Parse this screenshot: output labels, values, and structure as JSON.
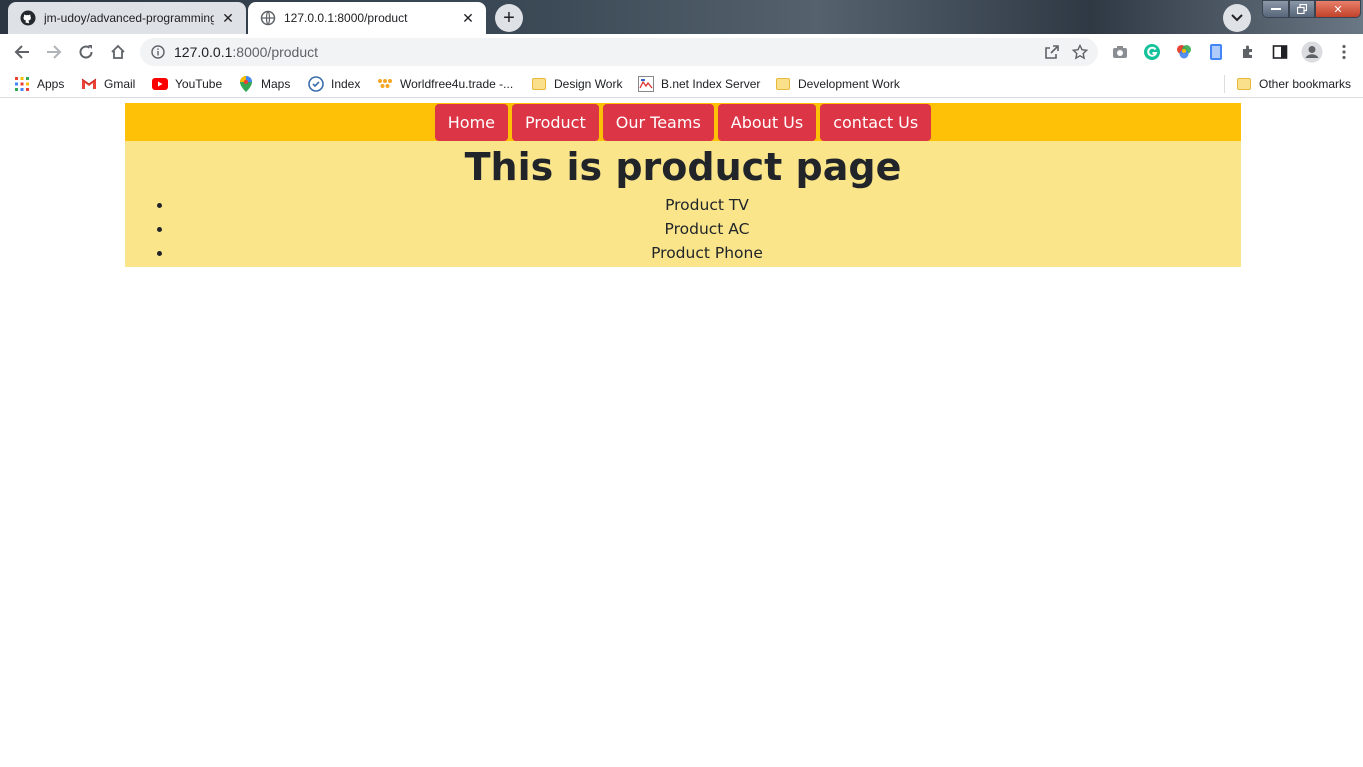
{
  "browser": {
    "tabs": [
      {
        "title": "jm-udoy/advanced-programming",
        "active": false
      },
      {
        "title": "127.0.0.1:8000/product",
        "active": true
      }
    ],
    "address": {
      "host": "127.0.0.1",
      "path": ":8000/product"
    },
    "bookmarks": [
      {
        "label": "Apps",
        "icon": "apps-grid-icon"
      },
      {
        "label": "Gmail",
        "icon": "gmail-icon"
      },
      {
        "label": "YouTube",
        "icon": "youtube-icon"
      },
      {
        "label": "Maps",
        "icon": "maps-pin-icon"
      },
      {
        "label": "Index",
        "icon": "index-globe-icon"
      },
      {
        "label": "Worldfree4u.trade -...",
        "icon": "worldfree-icon"
      },
      {
        "label": "Design Work",
        "icon": "folder-icon"
      },
      {
        "label": "B.net Index Server",
        "icon": "bnet-icon"
      },
      {
        "label": "Development Work",
        "icon": "folder-icon"
      }
    ],
    "other_bookmarks": "Other bookmarks"
  },
  "site": {
    "nav": [
      "Home",
      "Product",
      "Our Teams",
      "About Us",
      "contact Us"
    ],
    "heading": "This is product page",
    "products": [
      "Product TV",
      "Product AC",
      "Product Phone"
    ]
  },
  "colors": {
    "navbar_bg": "#ffc107",
    "button_bg": "#dc3545",
    "content_bg": "#fae58b"
  }
}
